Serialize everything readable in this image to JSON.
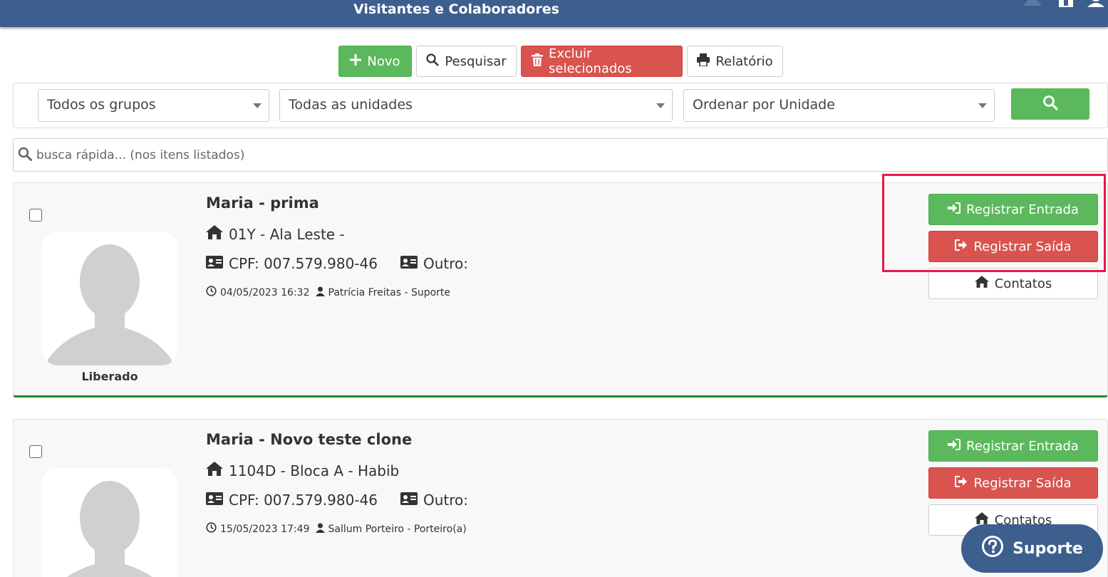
{
  "header": {
    "title": "Visitantes e Colaboradores"
  },
  "toolbar": {
    "novo": "Novo",
    "pesquisar": "Pesquisar",
    "excluir": "Excluir selecionados",
    "relatorio": "Relatório"
  },
  "filters": {
    "grupos": "Todos os grupos",
    "unidades": "Todas as unidades",
    "ordenar": "Ordenar por Unidade"
  },
  "quick_search": {
    "placeholder": "busca rápida... (nos itens listados)"
  },
  "cards": [
    {
      "name": "Maria - prima",
      "unit": "01Y - Ala Leste -",
      "cpf": "CPF: 007.579.980-46",
      "outro": "Outro:",
      "date": "04/05/2023 16:32",
      "user": "Patrícia Freitas - Suporte",
      "status": "Liberado",
      "entrada": "Registrar Entrada",
      "saida": "Registrar Saída",
      "contatos": "Contatos"
    },
    {
      "name": "Maria - Novo teste clone",
      "unit": "1104D - Bloca A - Habib",
      "cpf": "CPF: 007.579.980-46",
      "outro": "Outro:",
      "date": "15/05/2023 17:49",
      "user": "Sallum Porteiro - Porteiro(a)",
      "entrada": "Registrar Entrada",
      "saida": "Registrar Saída",
      "contatos": "Contatos"
    }
  ],
  "support": {
    "label": "Suporte"
  },
  "colors": {
    "header": "#3c5f8d",
    "green": "#5cb85c",
    "red": "#d9534f",
    "highlight": "#e8174a"
  }
}
